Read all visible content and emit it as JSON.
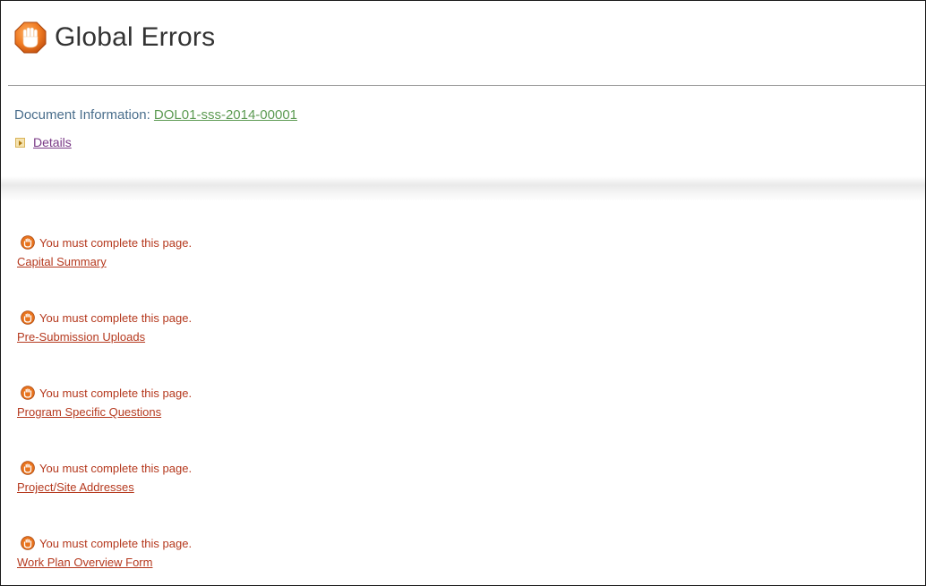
{
  "header": {
    "title": "Global Errors",
    "icon": "stop-hand-icon"
  },
  "document": {
    "label": "Document Information:",
    "id_link": "DOL01-sss-2014-00001",
    "details_label": "Details"
  },
  "errors": [
    {
      "message": "You must complete this page.",
      "page": "Capital Summary"
    },
    {
      "message": "You must complete this page.",
      "page": "Pre-Submission Uploads"
    },
    {
      "message": "You must complete this page.",
      "page": "Program Specific Questions"
    },
    {
      "message": "You must complete this page.",
      "page": "Project/Site Addresses"
    },
    {
      "message": "You must complete this page.",
      "page": "Work Plan Overview Form"
    }
  ],
  "colors": {
    "error_text": "#b5391e",
    "doc_label": "#4a6e8c",
    "doc_link": "#5c9a52",
    "details_link": "#7a3a86",
    "icon_orange": "#e8741e"
  }
}
